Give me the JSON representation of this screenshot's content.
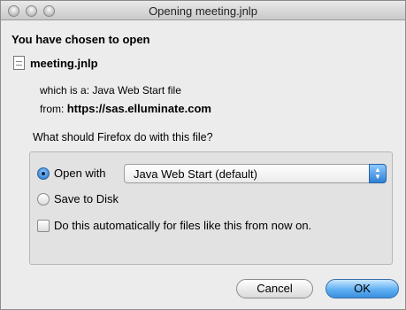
{
  "window": {
    "title": "Opening meeting.jnlp"
  },
  "dialog": {
    "heading": "You have chosen to open",
    "file_name": "meeting.jnlp",
    "type_label": "which is a:",
    "type_value": "Java Web Start file",
    "from_label": "from:",
    "from_value": "https://sas.elluminate.com",
    "question": "What should Firefox do with this file?",
    "options": {
      "open_with": "Open with",
      "open_with_app": "Java Web Start (default)",
      "save_to_disk": "Save to Disk",
      "auto_checkbox": "Do this automatically for files like this from now on."
    },
    "selected_option": "open_with",
    "auto_checked": false
  },
  "buttons": {
    "cancel": "Cancel",
    "ok": "OK"
  },
  "colors": {
    "window_bg": "#ececec",
    "accent_blue": "#3a8fdf"
  }
}
